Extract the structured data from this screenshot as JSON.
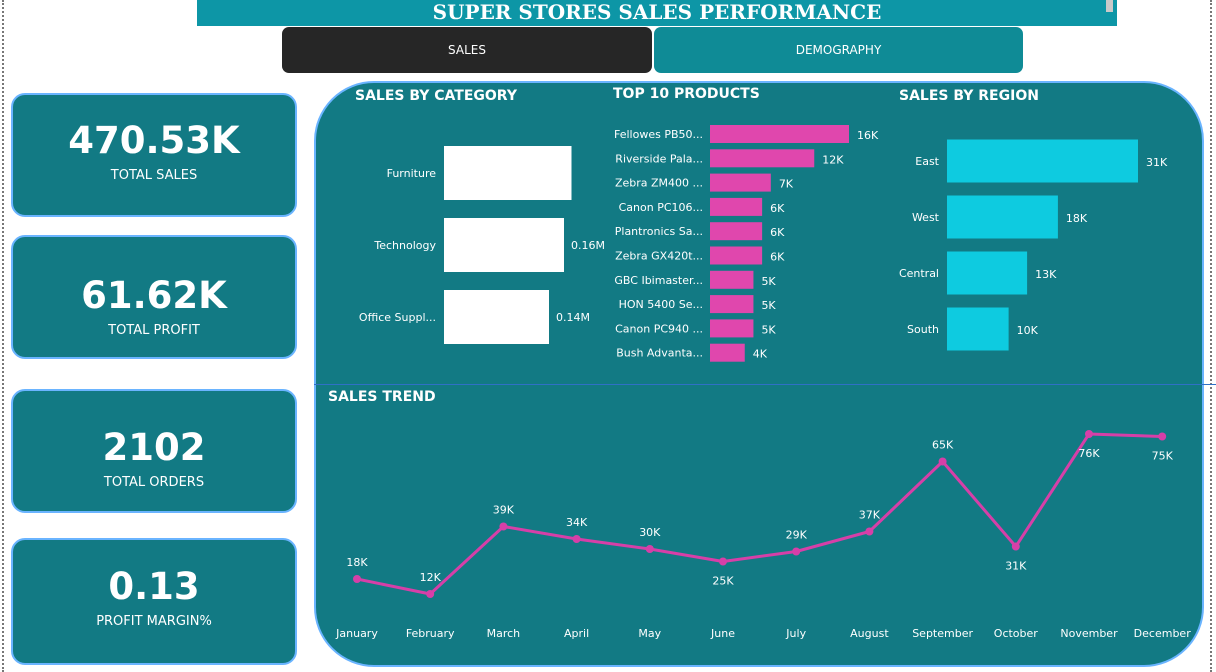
{
  "header": {
    "title": "SUPER STORES SALES PERFORMANCE"
  },
  "tabs": [
    {
      "label": "SALES"
    },
    {
      "label": "DEMOGRAPHY"
    }
  ],
  "kpis": [
    {
      "value": "470.53K",
      "label": "TOTAL SALES"
    },
    {
      "value": "61.62K",
      "label": "TOTAL PROFIT"
    },
    {
      "value": "2102",
      "label": "TOTAL ORDERS"
    },
    {
      "value": "0.13",
      "label": "PROFIT MARGIN%"
    }
  ],
  "colors": {
    "panel": "#127a84",
    "category_bar": "#ffffff",
    "product_bar": "#e047ad",
    "region_bar": "#0ecbe0",
    "trend_line": "#d63fa8",
    "panel_border": "#6ab4ff"
  },
  "chart_data": [
    {
      "type": "bar",
      "orientation": "horizontal",
      "title": "SALES BY CATEGORY",
      "categories": [
        "Furniture",
        "Technology",
        "Office Suppl..."
      ],
      "values": [
        170000,
        160000,
        140000
      ],
      "data_labels": [
        "",
        "0.16M",
        "0.14M"
      ],
      "grid": false
    },
    {
      "type": "bar",
      "orientation": "horizontal",
      "title": "TOP 10 PRODUCTS",
      "categories": [
        "Fellowes PB50...",
        "Riverside Pala...",
        "Zebra ZM400 ...",
        "Canon PC106...",
        "Plantronics Sa...",
        "Zebra GX420t...",
        "GBC Ibimaster...",
        "HON 5400 Se...",
        "Canon PC940 ...",
        "Bush Advanta..."
      ],
      "values": [
        16000,
        12000,
        7000,
        6000,
        6000,
        6000,
        5000,
        5000,
        5000,
        4000
      ],
      "data_labels": [
        "16K",
        "12K",
        "7K",
        "6K",
        "6K",
        "6K",
        "5K",
        "5K",
        "5K",
        "4K"
      ],
      "grid": false
    },
    {
      "type": "bar",
      "orientation": "horizontal",
      "title": "SALES BY REGION",
      "categories": [
        "East",
        "West",
        "Central",
        "South"
      ],
      "values": [
        31000,
        18000,
        13000,
        10000
      ],
      "data_labels": [
        "31K",
        "18K",
        "13K",
        "10K"
      ],
      "grid": false
    },
    {
      "type": "line",
      "title": "SALES TREND",
      "x": [
        "January",
        "February",
        "March",
        "April",
        "May",
        "June",
        "July",
        "August",
        "September",
        "October",
        "November",
        "December"
      ],
      "values": [
        18000,
        12000,
        39000,
        34000,
        30000,
        25000,
        29000,
        37000,
        65000,
        31000,
        76000,
        75000
      ],
      "data_labels": [
        "18K",
        "12K",
        "39K",
        "34K",
        "30K",
        "25K",
        "29K",
        "37K",
        "65K",
        "31K",
        "76K",
        "75K"
      ],
      "grid": false
    }
  ]
}
